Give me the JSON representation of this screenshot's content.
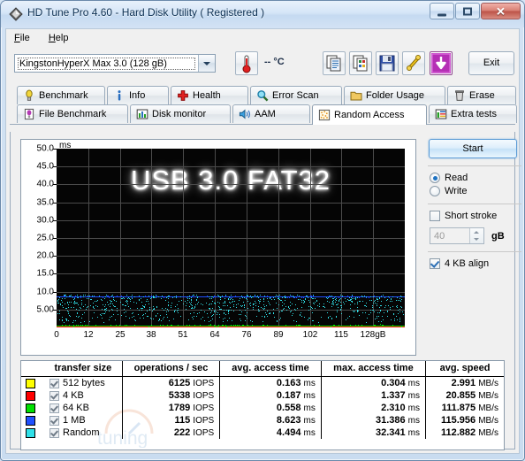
{
  "window": {
    "title": "HD Tune Pro 4.60 - Hard Disk Utility (  Registered )",
    "icon": "hdtune-diamond-icon",
    "minimize_label": "",
    "maximize_label": "",
    "close_label": "✕"
  },
  "menu": {
    "items": [
      {
        "label": "File",
        "accel": "F",
        "rest": "ile"
      },
      {
        "label": "Help",
        "accel": "H",
        "rest": "elp"
      }
    ]
  },
  "toolbar": {
    "drive": {
      "selected": "KingstonHyperX Max 3.0 (128 gB)",
      "icon": "chevron-down-icon"
    },
    "temperature": {
      "icon": "thermometer-icon",
      "value": "--  °C"
    },
    "buttons": [
      {
        "name": "copy-text-button",
        "icon": "copy-text-icon"
      },
      {
        "name": "copy-image-button",
        "icon": "copy-image-icon"
      },
      {
        "name": "save-button",
        "icon": "floppy-save-icon"
      },
      {
        "name": "clipboard-button",
        "icon": "wrench-clip-icon"
      },
      {
        "name": "download-button",
        "icon": "download-arrow-icon"
      }
    ],
    "exit_label": "Exit"
  },
  "tabs": {
    "row1": [
      {
        "label": "Benchmark",
        "icon": "bulb-icon",
        "active": false
      },
      {
        "label": "Info",
        "icon": "info-icon",
        "active": false
      },
      {
        "label": "Health",
        "icon": "cross-icon",
        "active": false
      },
      {
        "label": "Error Scan",
        "icon": "magnifier-icon",
        "active": false
      },
      {
        "label": "Folder Usage",
        "icon": "folder-icon",
        "active": false
      },
      {
        "label": "Erase",
        "icon": "trash-icon",
        "active": false
      }
    ],
    "row2": [
      {
        "label": "File Benchmark",
        "icon": "file-bench-icon",
        "active": false
      },
      {
        "label": "Disk monitor",
        "icon": "bar-chart-icon",
        "active": false
      },
      {
        "label": "AAM",
        "icon": "speaker-icon",
        "active": false
      },
      {
        "label": "Random Access",
        "icon": "scatter-dots-icon",
        "active": true
      },
      {
        "label": "Extra tests",
        "icon": "extra-chart-icon",
        "active": false
      }
    ]
  },
  "controls": {
    "start_label": "Start",
    "mode": {
      "read_label": "Read",
      "write_label": "Write",
      "selected": "Read"
    },
    "short_stroke": {
      "label": "Short stroke",
      "checked": false,
      "value": "40",
      "unit": "gB"
    },
    "align": {
      "label": "4 KB align",
      "checked": true
    }
  },
  "chart_data": {
    "type": "scatter",
    "title": "USB 3.0 FAT32",
    "overlay_text": "USB 3.0 FAT32",
    "ylabel": "ms",
    "xlabel": "",
    "ylim": [
      0,
      50
    ],
    "xlim": [
      0,
      128
    ],
    "grid": true,
    "legend_position": "table-below",
    "yticks": [
      "5.00",
      "10.0",
      "15.0",
      "20.0",
      "25.0",
      "30.0",
      "35.0",
      "40.0",
      "45.0",
      "50.0"
    ],
    "xticks": [
      "0",
      "12",
      "25",
      "38",
      "51",
      "64",
      "76",
      "89",
      "102",
      "115",
      "128gB"
    ],
    "series": [
      {
        "name": "512 bytes",
        "color": "#ffff00",
        "style": "line",
        "y_value": 0.163
      },
      {
        "name": "4 KB",
        "color": "#ff0000",
        "style": "line",
        "y_value": 0.187
      },
      {
        "name": "64 KB",
        "color": "#00e000",
        "style": "line",
        "y_value": 0.558
      },
      {
        "name": "1 MB",
        "color": "#2050ff",
        "style": "line",
        "y_value": 8.623
      },
      {
        "name": "Random",
        "color": "#30e0e8",
        "style": "scatter",
        "y_range": [
          0.4,
          9.2
        ],
        "points": 900
      }
    ]
  },
  "table": {
    "headers": [
      "transfer size",
      "operations / sec",
      "avg. access time",
      "max. access time",
      "avg. speed"
    ],
    "rows": [
      {
        "color": "#ffff00",
        "checked": true,
        "size": "512 bytes",
        "iops": "6125 IOPS",
        "avg_access": "0.163 ms",
        "max_access": "0.304 ms",
        "avg_speed": "2.991 MB/s"
      },
      {
        "color": "#ff0000",
        "checked": true,
        "size": "4 KB",
        "iops": "5338 IOPS",
        "avg_access": "0.187 ms",
        "max_access": "1.337 ms",
        "avg_speed": "20.855 MB/s"
      },
      {
        "color": "#00e000",
        "checked": true,
        "size": "64 KB",
        "iops": "1789 IOPS",
        "avg_access": "0.558 ms",
        "max_access": "2.310 ms",
        "avg_speed": "111.875 MB/s"
      },
      {
        "color": "#2050ff",
        "checked": true,
        "size": "1 MB",
        "iops": "115 IOPS",
        "avg_access": "8.623 ms",
        "max_access": "31.386 ms",
        "avg_speed": "115.956 MB/s"
      },
      {
        "color": "#30e0e8",
        "checked": true,
        "size": "Random",
        "iops": "222 IOPS",
        "avg_access": "4.494 ms",
        "max_access": "32.341 ms",
        "avg_speed": "112.882 MB/s"
      }
    ]
  }
}
